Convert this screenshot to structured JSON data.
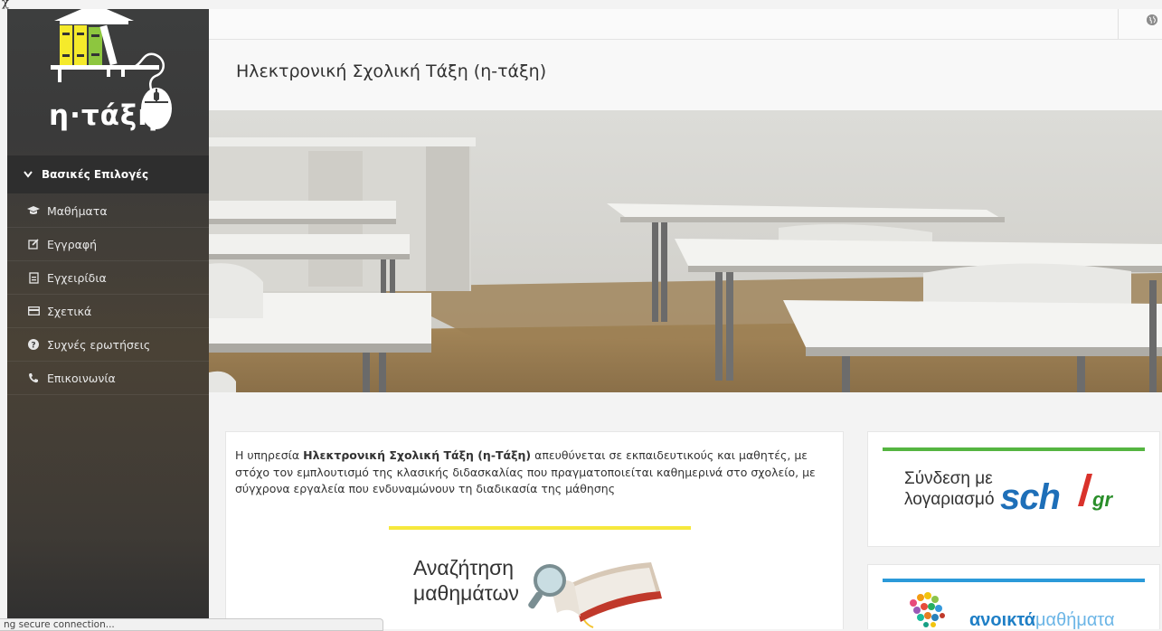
{
  "corner_glyph": "χ",
  "logo": {
    "text": "η·τάξη"
  },
  "sidebar": {
    "heading": "Βασικές Επιλογές",
    "items": [
      {
        "label": "Μαθήματα",
        "icon": "graduation-cap-icon"
      },
      {
        "label": "Εγγραφή",
        "icon": "edit-icon"
      },
      {
        "label": "Εγχειρίδια",
        "icon": "file-icon"
      },
      {
        "label": "Σχετικά",
        "icon": "card-icon"
      },
      {
        "label": "Συχνές ερωτήσεις",
        "icon": "question-circle-icon"
      },
      {
        "label": "Επικοινωνία",
        "icon": "phone-icon"
      }
    ]
  },
  "page": {
    "title": "Ηλεκτρονική Σχολική Τάξη (η-τάξη)"
  },
  "intro": {
    "prefix": "Η υπηρεσία ",
    "bold": "Ηλεκτρονική Σχολική Τάξη (η-Τάξη)",
    "suffix": " απευθύνεται σε εκπαιδευτικούς και μαθητές, με στόχο τον εμπλουτισμό της κλασικής διδασκαλίας που πραγματοποιείται καθημερινά στο σχολείο, με σύγχρονα εργαλεία που ενδυναμώνουν τη διαδικασία της μάθησης"
  },
  "search_banner": {
    "line1": "Αναζήτηση",
    "line2": "μαθημάτων"
  },
  "sch_login": {
    "line1": "Σύνδεση με",
    "line2": "λογαριασμό",
    "logo_text": "sch",
    "logo_suffix": "gr"
  },
  "open_courses": {
    "strong": "ανοικτά",
    "light": "μαθήματα"
  },
  "status_bar": {
    "text": "ng secure connection..."
  },
  "colors": {
    "sidebar_bg": "#3d3e3e",
    "green_accent": "#55b541",
    "blue_accent": "#2b9ad9",
    "yellow_accent": "#f6e83c"
  }
}
